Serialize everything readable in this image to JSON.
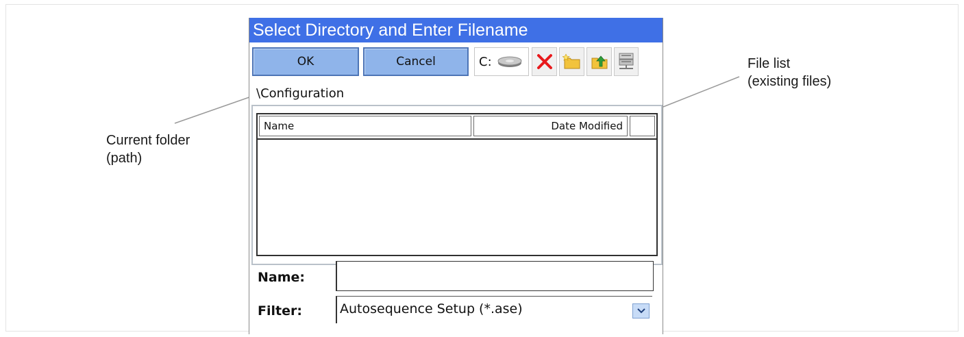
{
  "dialog": {
    "title": "Select Directory and Enter Filename",
    "ok_label": "OK",
    "cancel_label": "Cancel",
    "drive_label": "C:",
    "toolbar_icons": [
      "drive-icon",
      "delete-icon",
      "new-folder-icon",
      "up-folder-icon",
      "network-icon"
    ],
    "path": "\\Configuration",
    "columns": [
      "Name",
      "Date Modified"
    ],
    "name_label": "Name:",
    "name_value": "",
    "filter_label": "Filter:",
    "filter_value": "Autosequence Setup  (*.ase)"
  },
  "annotations": {
    "left": [
      "Current folder",
      "(path)"
    ],
    "right": [
      "File list",
      "(existing files)"
    ]
  },
  "colors": {
    "titlebar": "#3f70e6",
    "button": "#8fb4ea",
    "delete_icon": "#e8191c",
    "folder_icon": "#f2c33c"
  }
}
